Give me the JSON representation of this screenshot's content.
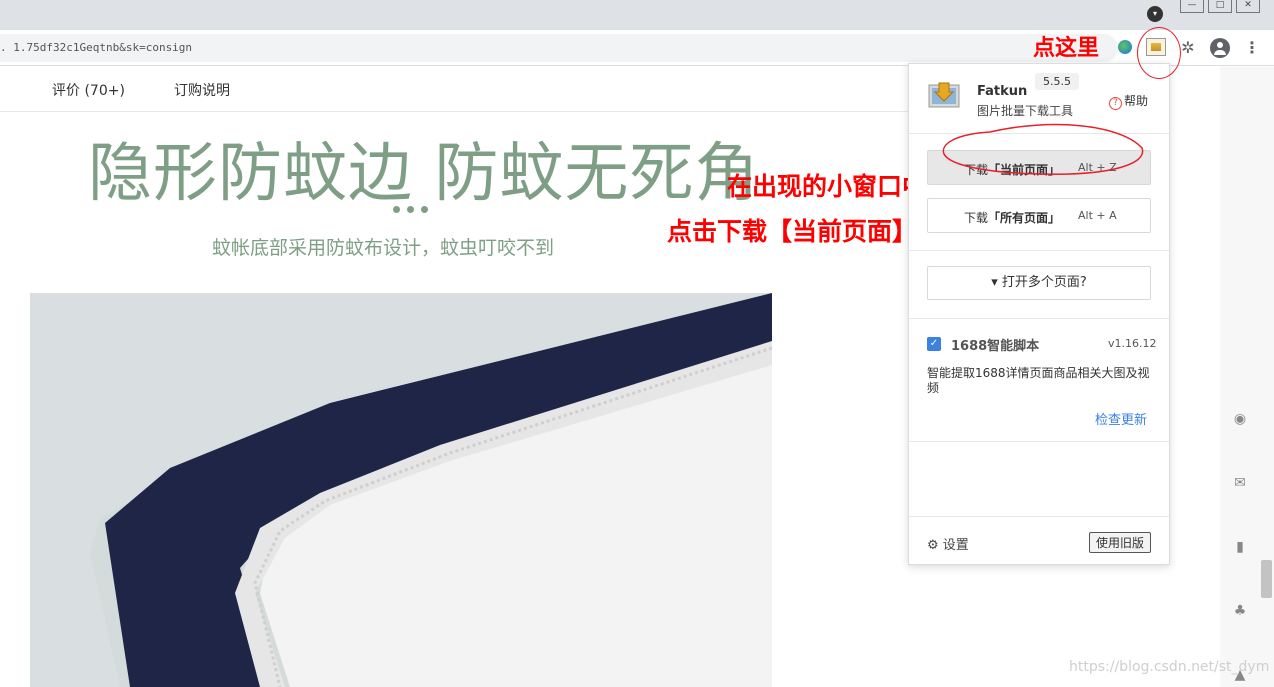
{
  "browser": {
    "url": ". 1.75df32c1Geqtnb&sk=consign",
    "window_controls": [
      "—",
      "□",
      "✕"
    ],
    "tab_dropdown": "▾",
    "menu": "⋮",
    "puzzle": "✲"
  },
  "annotations": {
    "click_here": "点这里",
    "line1": "在出现的小窗口中",
    "line2": "点击下载【当前页面】",
    "color": "#ff0000"
  },
  "page": {
    "tabs": [
      "评价 (70+)",
      "订购说明"
    ],
    "headline": "隐形防蚊边 防蚊无死角",
    "subheadline": "蚊帐底部采用防蚊布设计，蚊虫叮咬不到",
    "accent_color": "#7e9f85"
  },
  "popup": {
    "app_name": "Fatkun",
    "app_subtitle": "图片批量下载工具",
    "version": "5.5.5",
    "help": "帮助",
    "download_current": {
      "prefix": "下载",
      "bold": "「当前页面」",
      "shortcut": "Alt + Z"
    },
    "download_all": {
      "prefix": "下载",
      "bold": "「所有页面」",
      "shortcut": "Alt + A"
    },
    "open_multiple": "打开多个页面?",
    "script_name": "1688智能脚本",
    "script_version": "v1.16.12",
    "script_desc": "智能提取1688详情页面商品相关大图及视频",
    "check_update": "检查更新",
    "settings": "设置",
    "use_old": "使用旧版",
    "link_color": "#3b82e0"
  },
  "watermark": "https://blog.csdn.net/st_dym"
}
